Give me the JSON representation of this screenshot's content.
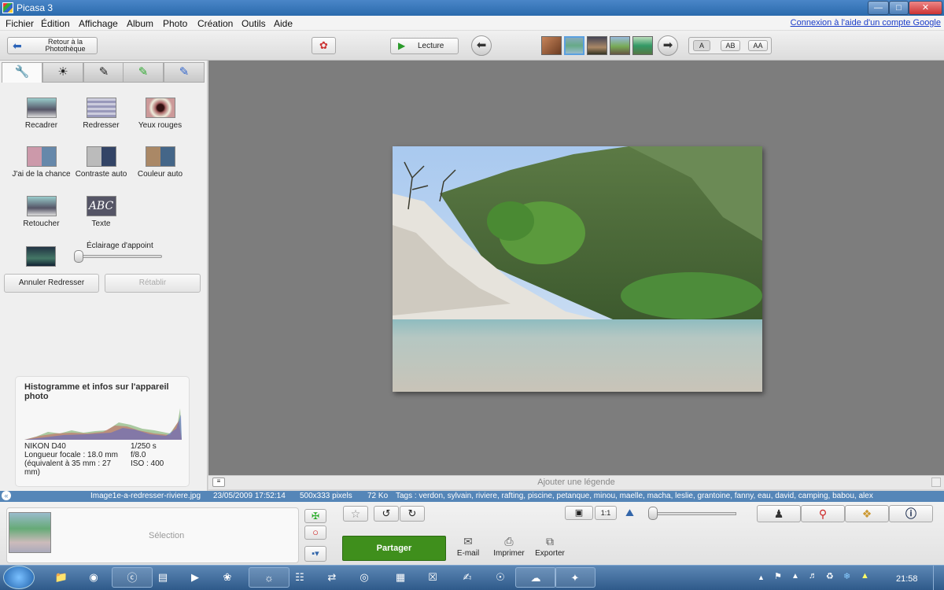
{
  "window": {
    "title": "Picasa 3"
  },
  "menu": {
    "items": [
      "Fichier",
      "Édition",
      "Affichage",
      "Album",
      "Photo",
      "Création",
      "Outils",
      "Aide"
    ],
    "help_link": "Connexion à l'aide d'un compte Google"
  },
  "toolbar": {
    "back_label": "Retour à la Photothèque",
    "play_label": "Lecture",
    "caption_modes": [
      "A",
      "AB",
      "AA"
    ]
  },
  "editpanel": {
    "tools": [
      {
        "label": "Recadrer"
      },
      {
        "label": "Redresser"
      },
      {
        "label": "Yeux rouges"
      },
      {
        "label": "J'ai de la chance"
      },
      {
        "label": "Contraste auto"
      },
      {
        "label": "Couleur auto"
      },
      {
        "label": "Retoucher"
      },
      {
        "label": "Texte"
      }
    ],
    "fill_light_label": "Éclairage d'appoint",
    "fill_light_value": 0,
    "undo_label": "Annuler Redresser",
    "redo_label": "Rétablir"
  },
  "histogram": {
    "title": "Histogramme et infos sur l'appareil photo",
    "camera": "NIKON D40",
    "focal": "Longueur focale : 18.0 mm",
    "equiv": "(équivalent à 35 mm : 27 mm)",
    "shutter": "1/250 s",
    "aperture": "f/8.0",
    "iso": "ISO : 400"
  },
  "caption": {
    "placeholder": "Ajouter une légende"
  },
  "infobar": {
    "filename": "Image1e-a-redresser-riviere.jpg",
    "datetime": "23/05/2009 17:52:14",
    "dimensions": "500x333 pixels",
    "size": "72 Ko",
    "tags": "Tags : verdon, sylvain, riviere, rafting, piscine, petanque, minou, maelle, macha, leslie, grantoine, fanny, eau, david, camping, babou, alex"
  },
  "bottom": {
    "selection_label": "Sélection",
    "share_label": "Partager",
    "email_label": "E-mail",
    "print_label": "Imprimer",
    "export_label": "Exporter",
    "zoom_one_label": "1:1",
    "zoom_value": 0
  },
  "taskbar": {
    "clock": "21:58"
  },
  "colors": {
    "share_button": "#3f8f1c",
    "infobar": "#5586b8",
    "taskbar": "#2f5a8a"
  }
}
